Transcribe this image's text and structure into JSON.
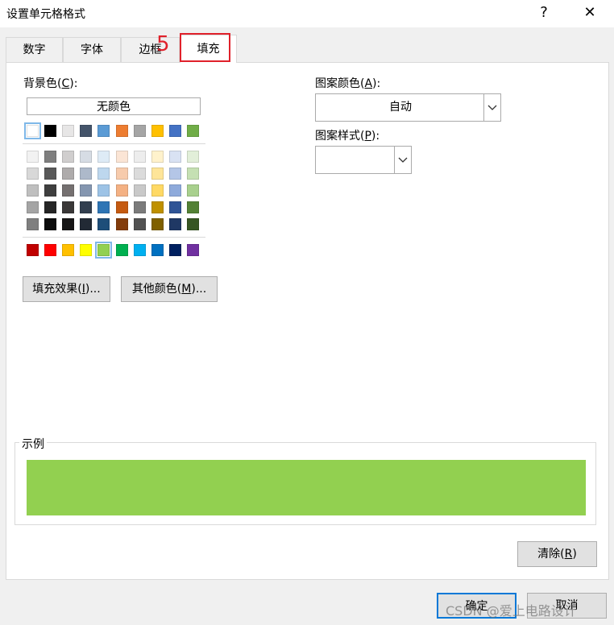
{
  "window": {
    "title": "设置单元格格式",
    "help_glyph": "?",
    "close_glyph": "✕"
  },
  "tabs": [
    {
      "label": "数字"
    },
    {
      "label": "字体"
    },
    {
      "label": "边框"
    },
    {
      "label": "填充",
      "active": true
    }
  ],
  "annotation": {
    "text": "5",
    "color": "#e0212b"
  },
  "background_color": {
    "label_prefix": "背景色(",
    "label_key": "C",
    "label_suffix": "):",
    "no_color_label": "无颜色",
    "theme_top_row": [
      "#ffffff",
      "#000000",
      "#e7e6e6",
      "#44546a",
      "#5b9bd5",
      "#ed7d31",
      "#a5a5a5",
      "#ffc000",
      "#4472c4",
      "#70ad47"
    ],
    "theme_shades": [
      [
        "#f2f2f2",
        "#7f7f7f",
        "#d0cece",
        "#d6dce4",
        "#deebf6",
        "#fbe5d5",
        "#ededed",
        "#fff2cc",
        "#d9e2f3",
        "#e2efd9"
      ],
      [
        "#d8d8d8",
        "#595959",
        "#aeabab",
        "#adb9ca",
        "#bdd7ee",
        "#f7cbac",
        "#dbdbdb",
        "#fee599",
        "#b4c6e7",
        "#c5e0b3"
      ],
      [
        "#bfbfbf",
        "#3f3f3f",
        "#757070",
        "#8496b0",
        "#9dc3e6",
        "#f4b183",
        "#c9c9c9",
        "#ffd965",
        "#8eaadb",
        "#a8d08d"
      ],
      [
        "#a5a5a5",
        "#262626",
        "#3a3838",
        "#323f4f",
        "#2e75b5",
        "#c55a11",
        "#7b7b7b",
        "#bf9000",
        "#2f5496",
        "#538135"
      ],
      [
        "#7f7f7f",
        "#0c0c0c",
        "#171616",
        "#222a35",
        "#1e4e79",
        "#833c0b",
        "#525252",
        "#7f6000",
        "#1f3864",
        "#375623"
      ]
    ],
    "standard_colors": [
      "#c00000",
      "#ff0000",
      "#ffc000",
      "#ffff00",
      "#92d050",
      "#00b050",
      "#00b0f0",
      "#0070c0",
      "#002060",
      "#7030a0"
    ],
    "selected_standard_index": 4
  },
  "buttons": {
    "fill_effects": {
      "prefix": "填充效果(",
      "key": "I",
      "suffix": ")..."
    },
    "more_colors": {
      "prefix": "其他颜色(",
      "key": "M",
      "suffix": ")..."
    },
    "clear": {
      "prefix": "清除(",
      "key": "R",
      "suffix": ")"
    },
    "ok": "确定",
    "cancel": "取消"
  },
  "pattern_color": {
    "label_prefix": "图案颜色(",
    "label_key": "A",
    "label_suffix": "):",
    "value": "自动"
  },
  "pattern_style": {
    "label_prefix": "图案样式(",
    "label_key": "P",
    "label_suffix": "):",
    "value": ""
  },
  "sample": {
    "label": "示例",
    "color": "#92d050"
  },
  "watermark": "CSDN @爱上电路设计"
}
